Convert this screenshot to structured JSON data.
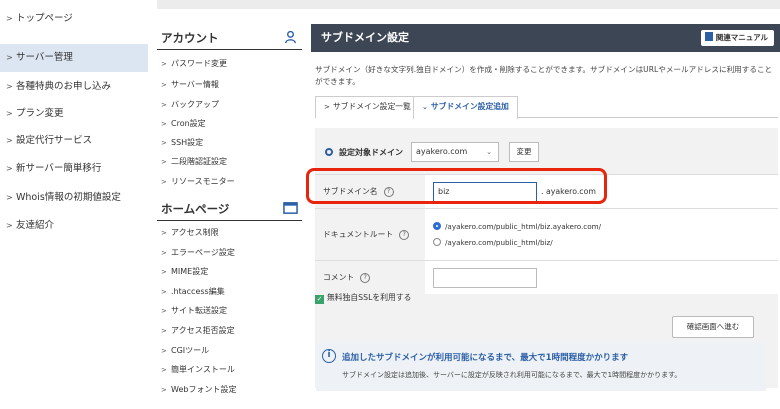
{
  "left_nav": [
    {
      "label": "トップページ"
    },
    {
      "label": "サーバー管理"
    },
    {
      "label": "各種特典のお申し込み"
    },
    {
      "label": "プラン変更"
    },
    {
      "label": "設定代行サービス"
    },
    {
      "label": "新サーバー簡単移行"
    },
    {
      "label": "Whois情報の初期値設定"
    },
    {
      "label": "友達紹介"
    }
  ],
  "menu": {
    "account_title": "アカウント",
    "account_items": [
      "パスワード変更",
      "サーバー情報",
      "バックアップ",
      "Cron設定",
      "SSH設定",
      "二段階認証設定",
      "リソースモニター"
    ],
    "homepage_title": "ホームページ",
    "homepage_items": [
      "アクセス制限",
      "エラーページ設定",
      "MIME設定",
      ".htaccess編集",
      "サイト転送設定",
      "アクセス拒否設定",
      "CGIツール",
      "簡単インストール",
      "Webフォント設定"
    ]
  },
  "main": {
    "title": "サブドメイン設定",
    "manual_label": "関連マニュアル",
    "description": "サブドメイン（好きな文字列.独自ドメイン）を作成・削除することができます。サブドメインはURLやメールアドレスに利用することができます。",
    "tabs": [
      "サブドメイン設定一覧",
      "サブドメイン設定追加"
    ],
    "target_domain_label": "設定対象ドメイン",
    "target_domain_value": "ayakero.com",
    "change_label": "変更",
    "subdomain_label": "サブドメイン名",
    "subdomain_value": "biz",
    "subdomain_suffix": ". ayakero.com",
    "docroot_label": "ドキュメントルート",
    "docroot_options": [
      "/ayakero.com/public_html/biz.ayakero.com/",
      "/ayakero.com/public_html/biz/"
    ],
    "comment_label": "コメント",
    "comment_value": "",
    "ssl_label": "無料独自SSLを利用する",
    "confirm_label": "確認画面へ進む",
    "notice_title": "追加したサブドメインが利用可能になるまで、最大で1時間程度かかります",
    "notice_text": "サブドメイン設定は追加後、サーバーに設定が反映され利用可能になるまで、最大で1時間程度かかります。"
  },
  "colors": {
    "header_bg": "#3d4654",
    "accent": "#2b5fa6",
    "highlight": "#e8250c",
    "active_nav": "#dce6f3"
  }
}
